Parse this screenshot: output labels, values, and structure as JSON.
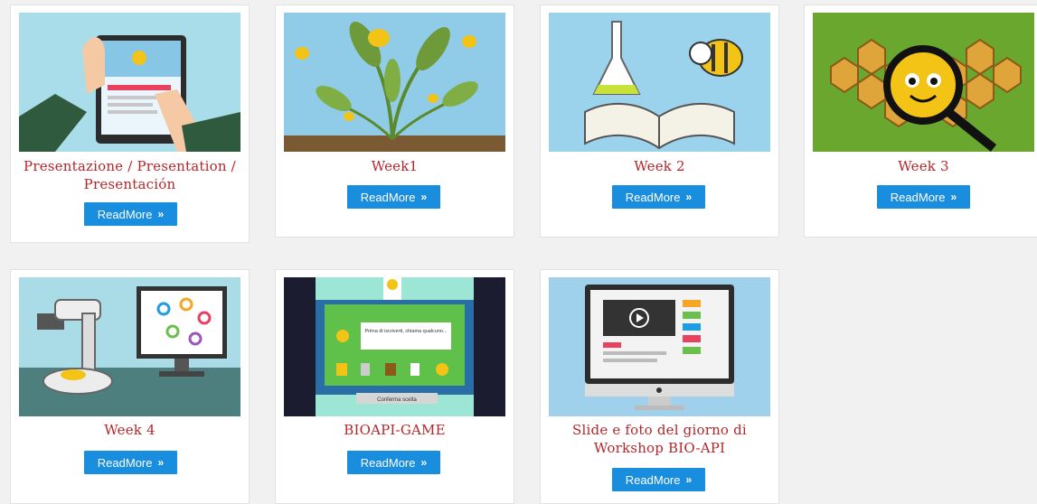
{
  "cards": [
    {
      "title": "Presentazione / Presentation / Presentación",
      "button_label": "ReadMore",
      "thumb_icon": "tablet-bee-icon"
    },
    {
      "title": "Week1",
      "button_label": "ReadMore",
      "thumb_icon": "plant-bees-icon"
    },
    {
      "title": "Week 2",
      "button_label": "ReadMore",
      "thumb_icon": "book-flask-bee-icon"
    },
    {
      "title": "Week 3",
      "button_label": "ReadMore",
      "thumb_icon": "honeycomb-magnifier-icon"
    },
    {
      "title": "Week 4",
      "button_label": "ReadMore",
      "thumb_icon": "microscope-monitor-icon"
    },
    {
      "title": "BIOAPI-GAME",
      "button_label": "ReadMore",
      "thumb_icon": "arcade-game-icon"
    },
    {
      "title": "Slide e foto del giorno di Workshop BIO-API",
      "button_label": "ReadMore",
      "thumb_icon": "video-monitor-icon"
    }
  ],
  "chevron": "»",
  "game_screen": {
    "question": "Prima di iscriverti, chiama qualcuno...",
    "footer_label": "Conferma scelta"
  },
  "colors": {
    "title": "#b5262a",
    "button": "#1a8ede",
    "background": "#f1f1f1"
  }
}
